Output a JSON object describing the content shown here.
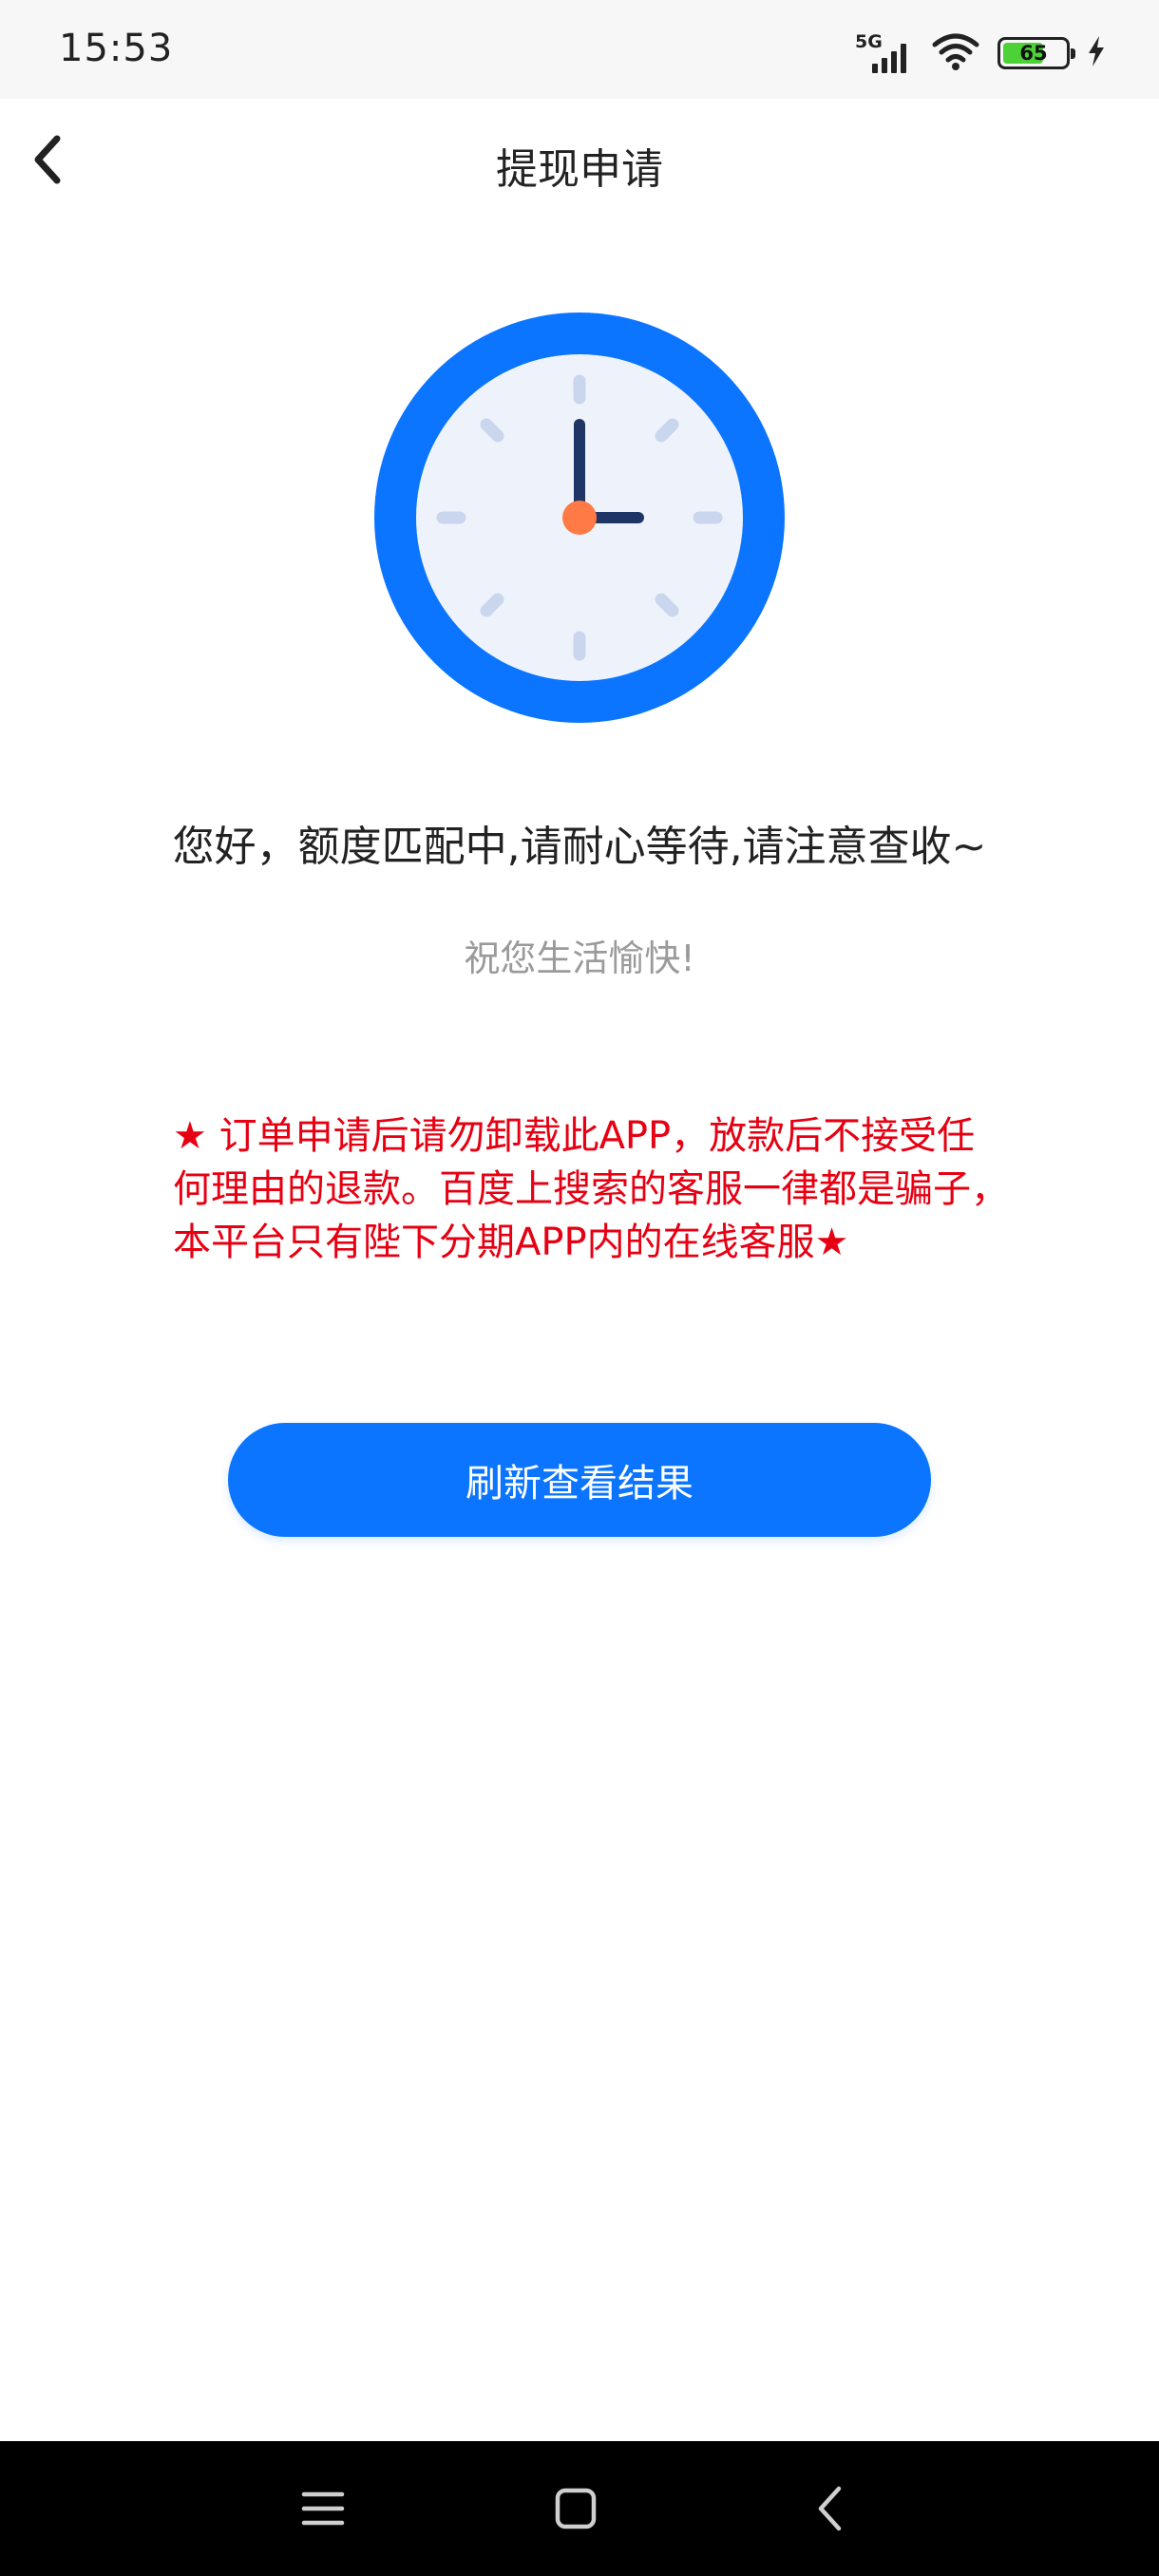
{
  "status_bar": {
    "time": "15:53",
    "network": "5G",
    "battery_level": "65",
    "battery_fraction": 0.65,
    "charging": true
  },
  "header": {
    "title": "提现申请",
    "back_icon": "chevron-left-icon"
  },
  "illustration": {
    "icon": "clock-icon",
    "colors": {
      "ring": "#0b75ff",
      "face": "#eef3fb",
      "hands": "#1f3566",
      "center": "#ff7a45",
      "ticks": "#c9d6ee"
    }
  },
  "main": {
    "message": "您好，额度匹配中,请耐心等待,请注意查收~",
    "sub_message": "祝您生活愉快!",
    "warning": "★ 订单申请后请勿卸载此APP，放款后不接受任何理由的退款。百度上搜索的客服一律都是骗子，本平台只有陛下分期APP内的在线客服★",
    "refresh_button_label": "刷新查看结果"
  },
  "colors": {
    "accent": "#0b75ff",
    "warning": "#e60012",
    "muted_text": "#9a9a9a"
  },
  "system_nav": {
    "menu_icon": "menu-icon",
    "home_icon": "home-icon",
    "back_icon": "back-icon"
  }
}
